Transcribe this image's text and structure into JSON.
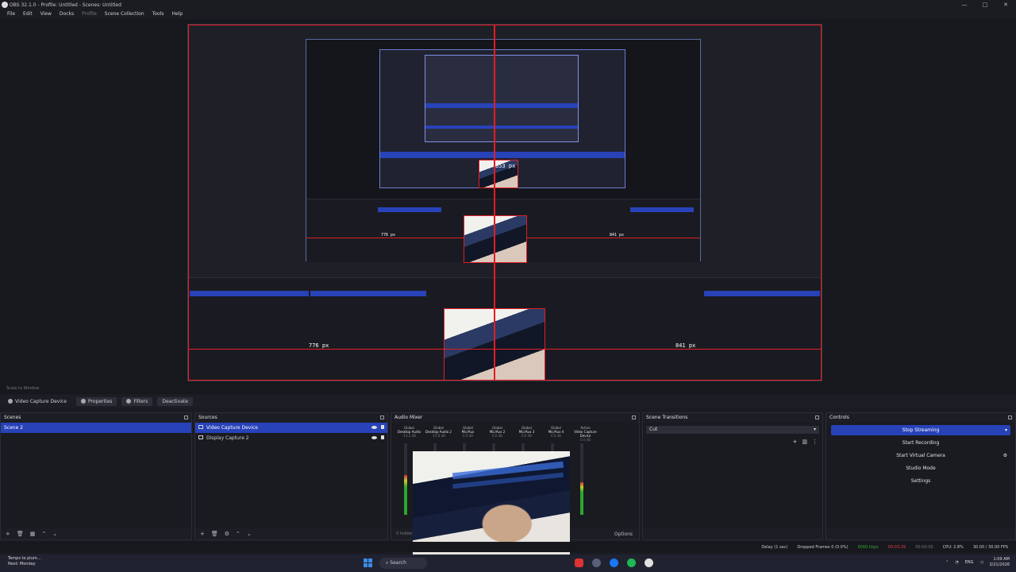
{
  "window": {
    "title": "OBS 32.1.0 - Profile: Untitled - Scenes: Untitled",
    "minimize": "—",
    "maximize": "□",
    "close": "✕"
  },
  "menu": [
    "File",
    "Edit",
    "View",
    "Docks",
    "Profile",
    "Scene Collection",
    "Tools",
    "Help"
  ],
  "preview": {
    "left_px_label": "776 px",
    "right_px_label": "841 px",
    "inner_left_label": "776 px",
    "inner_right_label": "841 px",
    "center_label": "853 px"
  },
  "scale": "Scale to Window",
  "source_toolbar": {
    "source_name": "Video Capture Device",
    "properties": "Properties",
    "filters": "Filters",
    "deactivate": "Deactivate"
  },
  "docks": {
    "scenes": {
      "title": "Scenes",
      "items": [
        "Scene 2"
      ]
    },
    "sources": {
      "title": "Sources",
      "items": [
        "Video Capture Device",
        "Display Capture 2"
      ]
    },
    "mixer": {
      "title": "Audio Mixer",
      "channels": [
        {
          "name": "Desktop Audio",
          "sub": "Global",
          "db": "-13.2 dB",
          "level": 0.55
        },
        {
          "name": "Desktop Audio 2",
          "sub": "Global",
          "db": "-15.8 dB",
          "level": 0.3
        },
        {
          "name": "Mic/Aux",
          "sub": "Global",
          "db": "0.0 dB",
          "level": 0.2
        },
        {
          "name": "Mic/Aux 2",
          "sub": "Global",
          "db": "0.0 dB",
          "level": 0.15
        },
        {
          "name": "Mic/Aux 3",
          "sub": "Global",
          "db": "0.0 dB",
          "level": 0.1
        },
        {
          "name": "Mic/Aux 4",
          "sub": "Global",
          "db": "0.0 dB",
          "level": 0.1
        },
        {
          "name": "Video Capture Device",
          "sub": "Active",
          "db": "0.0 dB",
          "level": 0.45
        }
      ],
      "footer_text": "0 hidden",
      "options": "Options"
    },
    "transitions": {
      "title": "Scene Transitions",
      "selected": "Cut"
    },
    "controls": {
      "title": "Controls",
      "buttons": [
        "Stop Streaming",
        "Start Recording",
        "Start Virtual Camera",
        "Studio Mode",
        "Settings"
      ]
    }
  },
  "status": {
    "delay": "Delay (1 sec)",
    "dropped": "Dropped Frames 0 (0.0%)",
    "bitrate": "6060 kbps",
    "live": "00:03:29",
    "rec": "00:00:00",
    "cpu": "CPU: 2.8%",
    "fps": "30.00 / 30.00 FPS"
  },
  "taskbar": {
    "weather_line1": "Temps to plum...",
    "weather_line2": "Next: Monday",
    "search": "Search",
    "lang": "ENG",
    "time": "1:09 AM",
    "date": "3/21/2026"
  },
  "colors": {
    "accent": "#2842b8",
    "guide_red": "#e01e24",
    "background": "#1d1e25"
  }
}
